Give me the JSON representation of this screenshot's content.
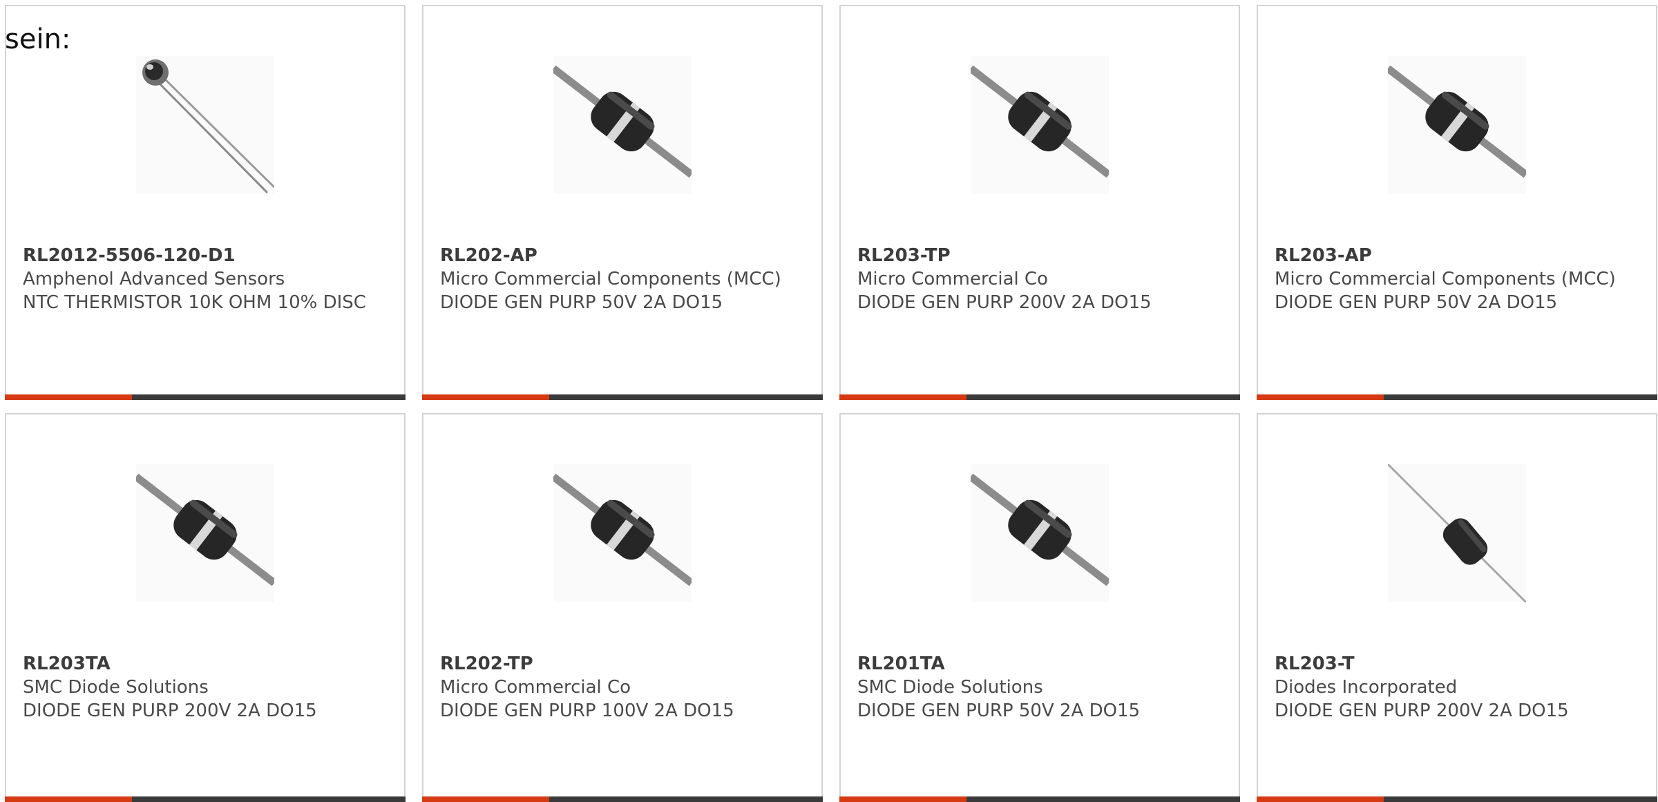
{
  "intro_text": "sein:",
  "colors": {
    "accent": "#d63a12",
    "bar": "#3a3a3a",
    "border": "#d3d3d3",
    "text": "#4a4a4a"
  },
  "products": [
    {
      "part_number": "RL2012-5506-120-D1",
      "manufacturer": "Amphenol Advanced Sensors",
      "description": "NTC THERMISTOR 10K OHM 10% DISC",
      "image_icon": "thermistor-icon"
    },
    {
      "part_number": "RL202-AP",
      "manufacturer": "Micro Commercial Components (MCC)",
      "description": "DIODE GEN PURP 50V 2A DO15",
      "image_icon": "diode-icon"
    },
    {
      "part_number": "RL203-TP",
      "manufacturer": "Micro Commercial Co",
      "description": "DIODE GEN PURP 200V 2A DO15",
      "image_icon": "diode-icon"
    },
    {
      "part_number": "RL203-AP",
      "manufacturer": "Micro Commercial Components (MCC)",
      "description": "DIODE GEN PURP 50V 2A DO15",
      "image_icon": "diode-icon"
    },
    {
      "part_number": "RL203TA",
      "manufacturer": "SMC Diode Solutions",
      "description": "DIODE GEN PURP 200V 2A DO15",
      "image_icon": "diode-icon"
    },
    {
      "part_number": "RL202-TP",
      "manufacturer": "Micro Commercial Co",
      "description": "DIODE GEN PURP 100V 2A DO15",
      "image_icon": "diode-icon"
    },
    {
      "part_number": "RL201TA",
      "manufacturer": "SMC Diode Solutions",
      "description": "DIODE GEN PURP 50V 2A DO15",
      "image_icon": "diode-icon"
    },
    {
      "part_number": "RL203-T",
      "manufacturer": "Diodes Incorporated",
      "description": "DIODE GEN PURP 200V 2A DO15",
      "image_icon": "diode-thin-icon"
    }
  ]
}
